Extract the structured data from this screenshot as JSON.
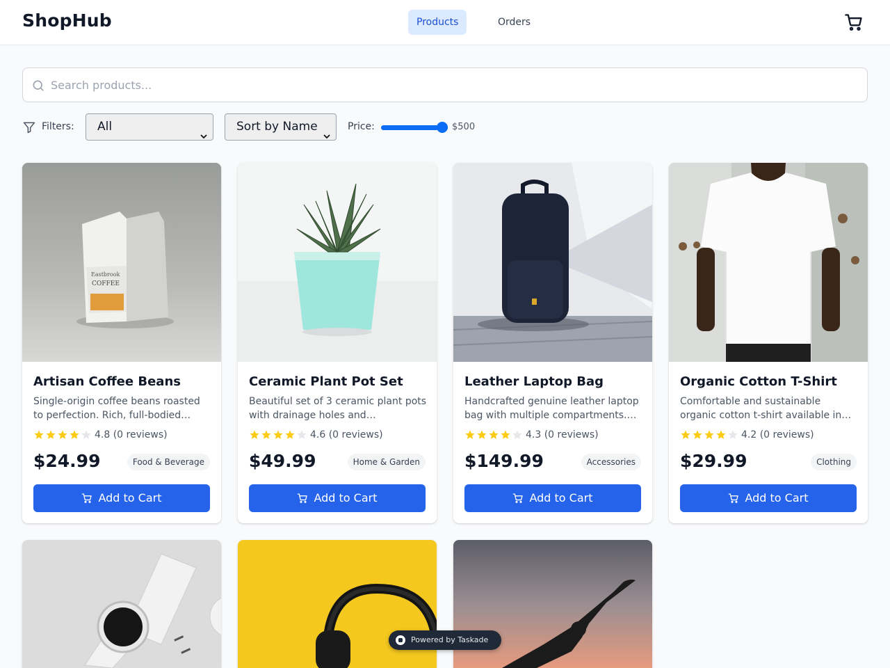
{
  "header": {
    "brand": "ShopHub",
    "tabs": [
      {
        "label": "Products",
        "active": true
      },
      {
        "label": "Orders",
        "active": false
      }
    ],
    "cart_icon": "shopping-cart-icon"
  },
  "search": {
    "placeholder": "Search products...",
    "value": "",
    "icon": "search-icon"
  },
  "filters": {
    "label": "Filters:",
    "icon": "filter-icon",
    "category_selected": "All",
    "sort_selected": "Sort by Name",
    "price_label": "Price:",
    "price_value": "$500",
    "price_slider_fraction": 1.0
  },
  "colors": {
    "accent": "#2563eb",
    "active_tab_bg": "#dbeafe",
    "star": "#facc15"
  },
  "products": [
    {
      "title": "Artisan Coffee Beans",
      "description": "Single-origin coffee beans roasted to perfection. Rich, full-bodied…",
      "rating": 4.8,
      "rating_text": "4.8 (0 reviews)",
      "price": "$24.99",
      "category": "Food & Beverage",
      "button": "Add to Cart",
      "image": "coffee-bag-photo"
    },
    {
      "title": "Ceramic Plant Pot Set",
      "description": "Beautiful set of 3 ceramic plant pots with drainage holes and…",
      "rating": 4.6,
      "rating_text": "4.6 (0 reviews)",
      "price": "$49.99",
      "category": "Home & Garden",
      "button": "Add to Cart",
      "image": "succulent-pot-photo"
    },
    {
      "title": "Leather Laptop Bag",
      "description": "Handcrafted genuine leather laptop bag with multiple compartments.…",
      "rating": 4.3,
      "rating_text": "4.3 (0 reviews)",
      "price": "$149.99",
      "category": "Accessories",
      "button": "Add to Cart",
      "image": "backpack-photo"
    },
    {
      "title": "Organic Cotton T-Shirt",
      "description": "Comfortable and sustainable organic cotton t-shirt available in…",
      "rating": 4.2,
      "rating_text": "4.2 (0 reviews)",
      "price": "$29.99",
      "category": "Clothing",
      "button": "Add to Cart",
      "image": "tshirt-photo"
    },
    {
      "image": "smartwatch-photo"
    },
    {
      "image": "headphones-photo"
    },
    {
      "image": "yoga-silhouette-photo"
    }
  ],
  "footer_badge": {
    "text": "Powered by Taskade"
  }
}
